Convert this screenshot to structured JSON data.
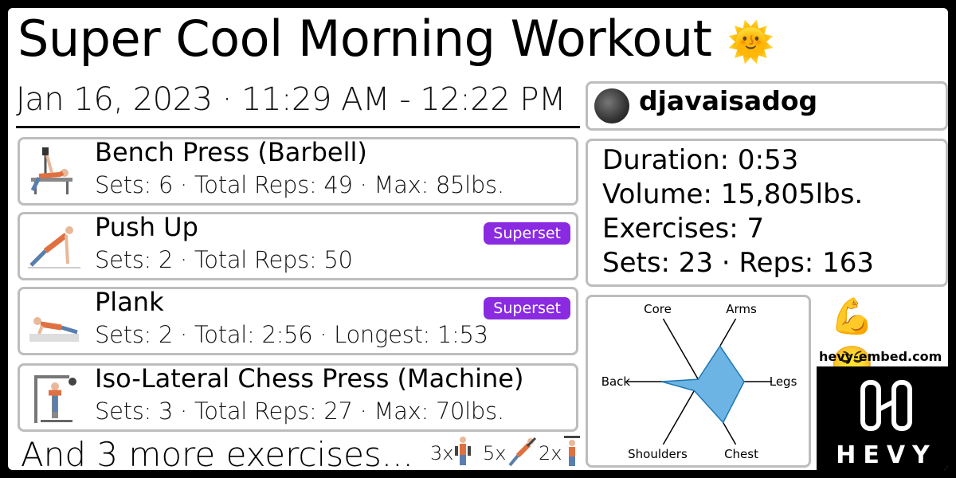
{
  "workout": {
    "title": "Super Cool Morning Workout",
    "title_emoji": "🌞",
    "date_time": "Jan 16, 2023 · 11:29 AM - 12:22 PM"
  },
  "user": {
    "username": "djavaisadog"
  },
  "exercises": [
    {
      "name": "Bench Press (Barbell)",
      "stats": "Sets: 6 · Total Reps: 49 · Max: 85lbs.",
      "icon": "bench-press-figure"
    },
    {
      "name": "Push Up",
      "stats": "Sets: 2 · Total Reps: 50",
      "badge": "Superset",
      "icon": "push-up-figure"
    },
    {
      "name": "Plank",
      "stats": "Sets: 2 · Total: 2:56 · Longest: 1:53",
      "badge": "Superset",
      "icon": "plank-figure"
    },
    {
      "name": "Iso-Lateral Chess Press (Machine)",
      "stats": "Sets: 3 · Total Reps: 27 · Max: 70lbs.",
      "icon": "chest-press-machine-figure"
    }
  ],
  "more": {
    "text": "And 3 more exercises...",
    "counts": [
      "3x",
      "5x",
      "2x"
    ]
  },
  "summary": {
    "duration": "Duration: 0:53",
    "volume": "Volume: 15,805lbs.",
    "exercises": "Exercises: 7",
    "sets_reps": "Sets: 23 · Reps: 163"
  },
  "chart_data": {
    "type": "radar",
    "categories": [
      "Core",
      "Arms",
      "Legs",
      "Chest",
      "Shoulders",
      "Back"
    ],
    "values": [
      0.05,
      0.78,
      0.85,
      0.9,
      0.2,
      0.72
    ],
    "fill_color": "#6cb4e4",
    "stroke_color": "#1f77b4"
  },
  "branding": {
    "site": "hevy-embed.com",
    "logo_text": "HEVY",
    "emoji": "💪😤"
  },
  "colors": {
    "badge": "#8a2be2",
    "border": "#bdbdbd",
    "background": "#000000"
  }
}
